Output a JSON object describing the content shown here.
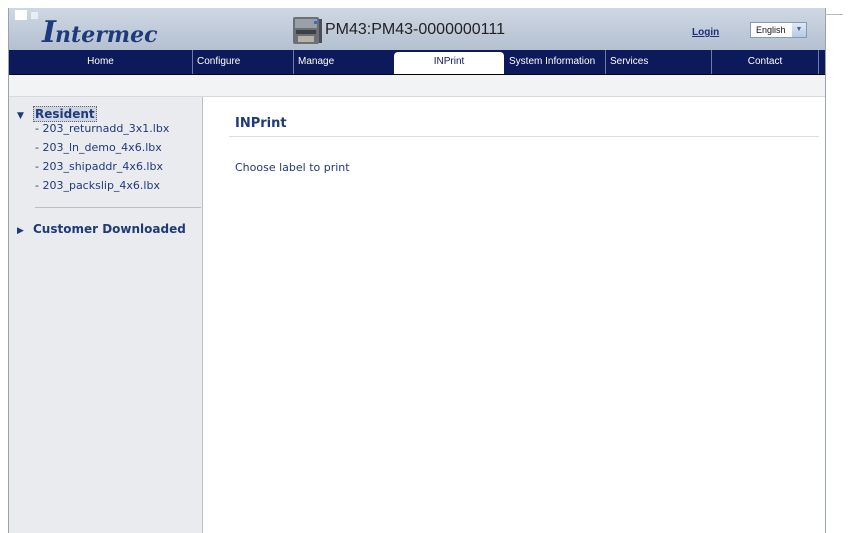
{
  "header": {
    "logo_first": "I",
    "logo_rest": "ntermec",
    "printer_title": "PM43:PM43-0000000111",
    "login_label": "Login",
    "language_selected": "English"
  },
  "nav": {
    "home": "Home",
    "configure": "Configure",
    "manage": "Manage",
    "inprint": "INPrint",
    "system_information": "System Information",
    "services": "Services",
    "contact": "Contact",
    "active": "INPrint"
  },
  "sidebar": {
    "resident_label": "Resident",
    "resident_files": [
      "- 203_returnadd_3x1.lbx",
      "- 203_ln_demo_4x6.lbx",
      "- 203_shipaddr_4x6.lbx",
      "- 203_packslip_4x6.lbx"
    ],
    "customer_label": "Customer Downloaded"
  },
  "main": {
    "title": "INPrint",
    "instruction": "Choose label to print"
  },
  "colors": {
    "nav_bg": "#0c1a5c",
    "text_blue": "#1f3a7a",
    "header_bg": "#c3ccda",
    "sidebar_bg": "#e9ebef"
  },
  "icons": {
    "printer": "printer-icon",
    "expanded": "triangle-down-icon",
    "collapsed": "triangle-right-icon",
    "dropdown": "chevron-down-icon"
  }
}
